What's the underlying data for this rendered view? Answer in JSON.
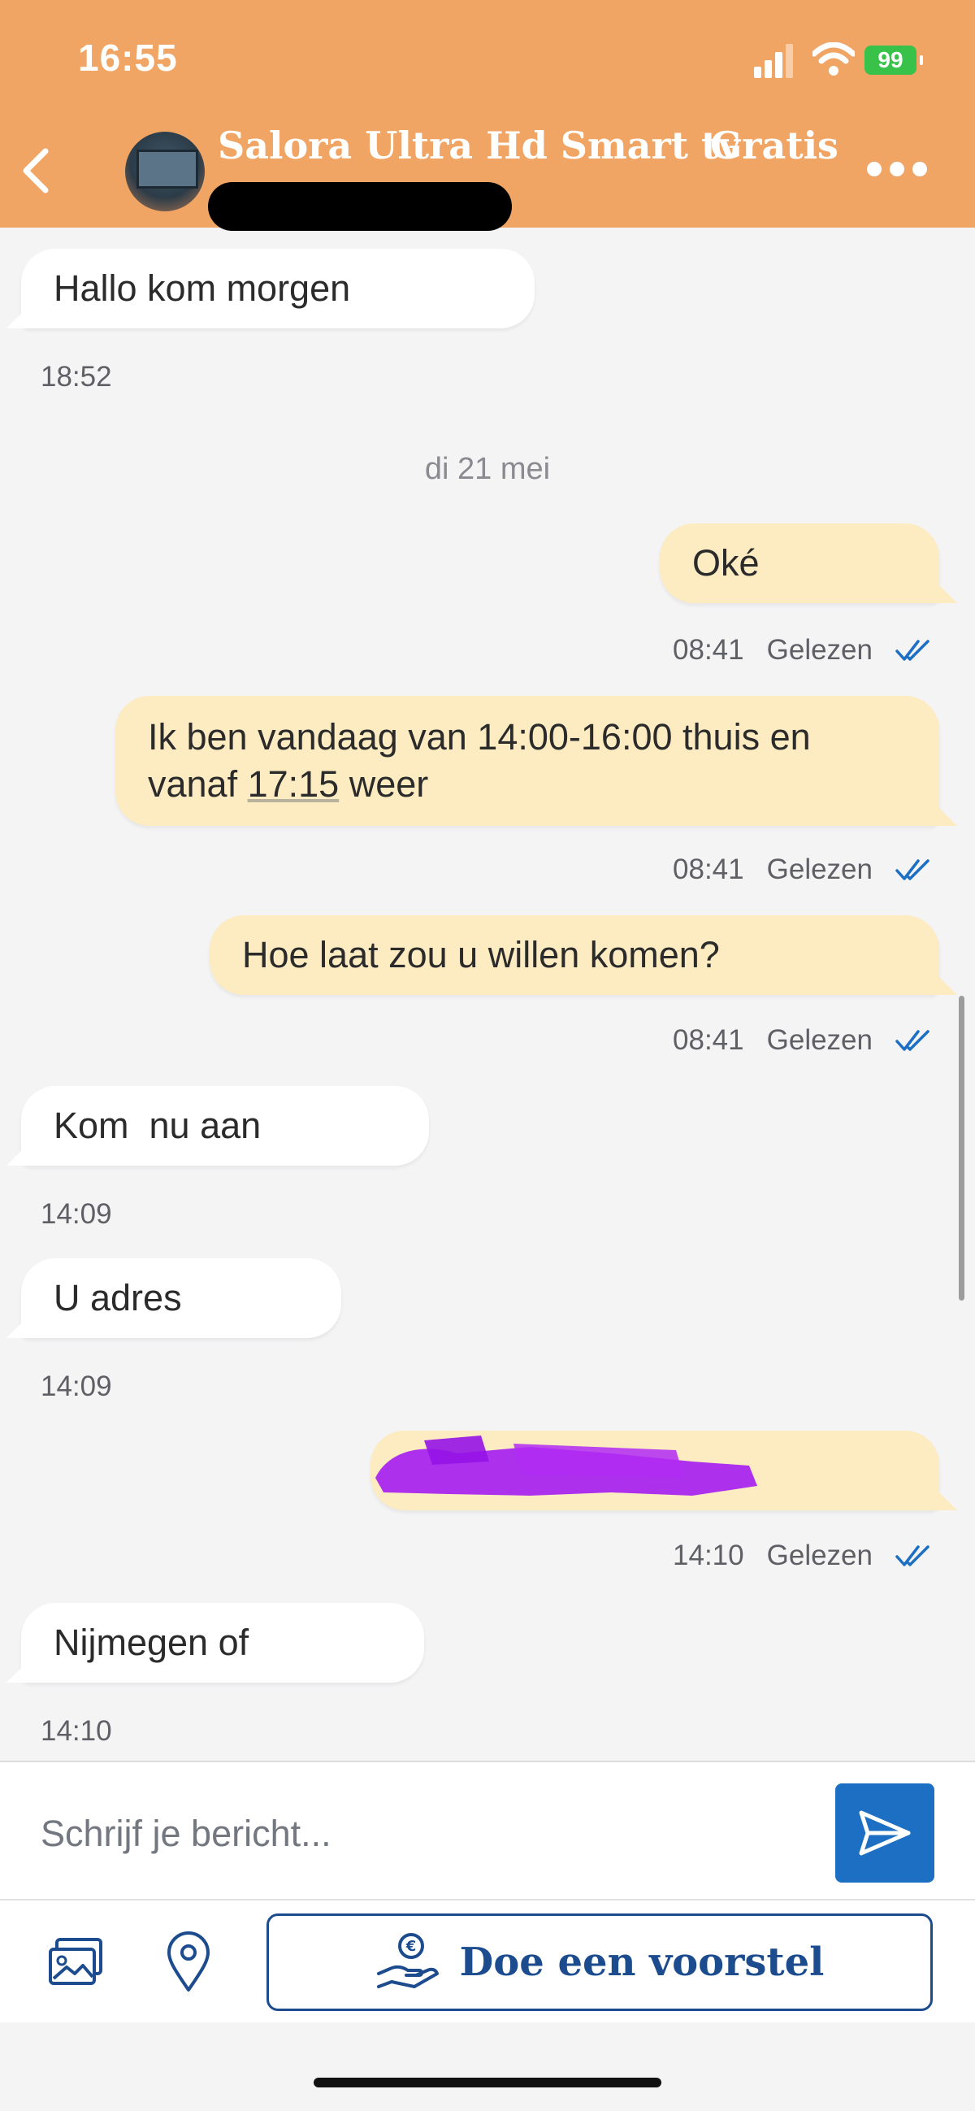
{
  "status_bar": {
    "time": "16:55",
    "battery": "99"
  },
  "header": {
    "title": "Salora Ultra Hd Smart tv",
    "price": "Gratis"
  },
  "messages": [
    {
      "side": "in",
      "text": "Hallo kom morgen",
      "time": "18:52"
    },
    {
      "type": "date",
      "text": "di 21 mei"
    },
    {
      "side": "out",
      "text": "Oké",
      "time": "08:41",
      "status": "Gelezen"
    },
    {
      "side": "out",
      "text_line1": "Ik ben vandaag van 14:00-16:00 thuis en",
      "text_line2_pre": "vanaf ",
      "text_line2_link": "17:15",
      "text_line2_post": " weer",
      "time": "08:41",
      "status": "Gelezen"
    },
    {
      "side": "out",
      "text": "Hoe laat zou u willen komen?",
      "time": "08:41",
      "status": "Gelezen"
    },
    {
      "side": "in",
      "text": "Kom  nu aan",
      "time": "14:09"
    },
    {
      "side": "in",
      "text": "U adres",
      "time": "14:09"
    },
    {
      "side": "out",
      "text": "",
      "time": "14:10",
      "status": "Gelezen",
      "redacted": true
    },
    {
      "side": "in",
      "text": "Nijmegen of",
      "time": "14:10"
    }
  ],
  "composer": {
    "placeholder": "Schrijf je bericht..."
  },
  "actions": {
    "offer_label": "Doe een voorstel"
  },
  "colors": {
    "header": "#f0a564",
    "outgoing": "#fdebc1",
    "accent": "#1c6fc2"
  },
  "icons": [
    "back-icon",
    "more-icon",
    "send-icon",
    "image-icon",
    "location-pin-icon",
    "euro-hand-icon",
    "double-check-icon"
  ]
}
